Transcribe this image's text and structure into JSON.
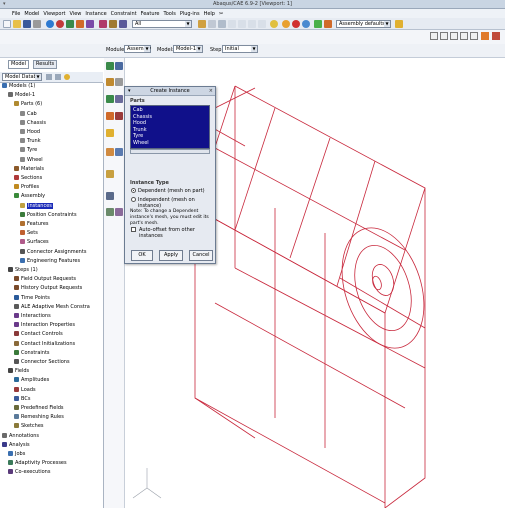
{
  "window": {
    "title": "Abaqus/CAE 6.9-2 [Viewport: 1]"
  },
  "menu": {
    "items": [
      "File",
      "Model",
      "Viewport",
      "View",
      "Instance",
      "Constraint",
      "Feature",
      "Tools",
      "Plug-ins",
      "Help",
      "✂"
    ]
  },
  "toolbar": {
    "render_style_value": "All",
    "assembly_defaults_value": "Assembly defaults"
  },
  "context_bar": {
    "module_label": "Module:",
    "module_value": "Assembly",
    "model_label": "Model:",
    "model_value": "Model-1",
    "step_label": "Step:",
    "step_value": "Initial"
  },
  "tabs": {
    "model": "Model",
    "results": "Results"
  },
  "tree_header": {
    "value": "Model Databa"
  },
  "tree": {
    "items": [
      {
        "label": "Models (1)",
        "indent": 0,
        "icon": "db-icon",
        "color": "#3a6fb0"
      },
      {
        "label": "Model-1",
        "indent": 1,
        "icon": "minus-icon",
        "color": "#6a6a6a"
      },
      {
        "label": "Parts (6)",
        "indent": 2,
        "icon": "parts-icon",
        "color": "#b08a30"
      },
      {
        "label": "Cab",
        "indent": 3,
        "icon": "plus-icon",
        "color": "#888"
      },
      {
        "label": "Chassis",
        "indent": 3,
        "icon": "plus-icon",
        "color": "#888"
      },
      {
        "label": "Hood",
        "indent": 3,
        "icon": "plus-icon",
        "color": "#888"
      },
      {
        "label": "Trunk",
        "indent": 3,
        "icon": "plus-icon",
        "color": "#888"
      },
      {
        "label": "Tyre",
        "indent": 3,
        "icon": "plus-icon",
        "color": "#888"
      },
      {
        "label": "Wheel",
        "indent": 3,
        "icon": "plus-icon",
        "color": "#888"
      },
      {
        "label": "Materials",
        "indent": 2,
        "icon": "materials-icon",
        "color": "#8c5a2a"
      },
      {
        "label": "Sections",
        "indent": 2,
        "icon": "sections-icon",
        "color": "#b03a3a"
      },
      {
        "label": "Profiles",
        "indent": 2,
        "icon": "profiles-icon",
        "color": "#c08a20"
      },
      {
        "label": "Assembly",
        "indent": 2,
        "icon": "assembly-icon",
        "color": "#3a8a3a"
      },
      {
        "label": "Instances",
        "indent": 3,
        "icon": "instances-icon",
        "color": "#c0a040",
        "selected": true
      },
      {
        "label": "Position Constraints",
        "indent": 3,
        "icon": "position-icon",
        "color": "#3a7a3a"
      },
      {
        "label": "Features",
        "indent": 3,
        "icon": "features-icon",
        "color": "#b07030"
      },
      {
        "label": "Sets",
        "indent": 3,
        "icon": "sets-icon",
        "color": "#c06030"
      },
      {
        "label": "Surfaces",
        "indent": 3,
        "icon": "surfaces-icon",
        "color": "#b05a8a"
      },
      {
        "label": "Connector Assignments",
        "indent": 3,
        "icon": "connector-icon",
        "color": "#555"
      },
      {
        "label": "Engineering Features",
        "indent": 3,
        "icon": "engineering-icon",
        "color": "#3a6fb0"
      },
      {
        "label": "Steps (1)",
        "indent": 1,
        "icon": "steps-icon",
        "color": "#444"
      },
      {
        "label": "Field Output Requests",
        "indent": 2,
        "icon": "field-output-icon",
        "color": "#7a4a2a"
      },
      {
        "label": "History Output Requests",
        "indent": 2,
        "icon": "history-output-icon",
        "color": "#7a4a2a"
      },
      {
        "label": "Time Points",
        "indent": 2,
        "icon": "time-icon",
        "color": "#2a5a9a"
      },
      {
        "label": "ALE Adaptive Mesh Constra",
        "indent": 2,
        "icon": "ale-icon",
        "color": "#5a5a5a"
      },
      {
        "label": "Interactions",
        "indent": 2,
        "icon": "interactions-icon",
        "color": "#6a3a8a"
      },
      {
        "label": "Interaction Properties",
        "indent": 2,
        "icon": "interaction-props-icon",
        "color": "#6a3a8a"
      },
      {
        "label": "Contact Controls",
        "indent": 2,
        "icon": "contact-controls-icon",
        "color": "#8a3a3a"
      },
      {
        "label": "Contact Initializations",
        "indent": 2,
        "icon": "contact-init-icon",
        "color": "#8a6a3a"
      },
      {
        "label": "Constraints",
        "indent": 2,
        "icon": "constraints-icon",
        "color": "#3a7a3a"
      },
      {
        "label": "Connector Sections",
        "indent": 2,
        "icon": "connector-sections-icon",
        "color": "#555"
      },
      {
        "label": "Fields",
        "indent": 1,
        "icon": "fields-icon",
        "color": "#444"
      },
      {
        "label": "Amplitudes",
        "indent": 2,
        "icon": "amplitudes-icon",
        "color": "#2a6a9a"
      },
      {
        "label": "Loads",
        "indent": 2,
        "icon": "loads-icon",
        "color": "#9a3a3a"
      },
      {
        "label": "BCs",
        "indent": 2,
        "icon": "bcs-icon",
        "color": "#3a5a9a"
      },
      {
        "label": "Predefined Fields",
        "indent": 2,
        "icon": "predefined-icon",
        "color": "#6a6a3a"
      },
      {
        "label": "Remeshing Rules",
        "indent": 2,
        "icon": "remeshing-icon",
        "color": "#5a7a9a"
      },
      {
        "label": "Sketches",
        "indent": 2,
        "icon": "sketches-icon",
        "color": "#8a7a3a"
      },
      {
        "label": "Annotations",
        "indent": 0,
        "icon": "annotations-icon",
        "color": "#6a6a6a"
      },
      {
        "label": "Analysis",
        "indent": 0,
        "icon": "analysis-icon",
        "color": "#3a3a8a"
      },
      {
        "label": "Jobs",
        "indent": 1,
        "icon": "jobs-icon",
        "color": "#3a6fb0"
      },
      {
        "label": "Adaptivity Processes",
        "indent": 1,
        "icon": "adaptivity-icon",
        "color": "#3a7a5a"
      },
      {
        "label": "Co-executions",
        "indent": 1,
        "icon": "coexec-icon",
        "color": "#5a3a7a"
      }
    ]
  },
  "dialog": {
    "title": "Create Instance",
    "parts_heading": "Parts",
    "parts": [
      "Cab",
      "Chassis",
      "Hood",
      "Trunk",
      "Tyre",
      "Wheel"
    ],
    "instance_type_heading": "Instance Type",
    "radio_dependent": "Dependent (mesh on part)",
    "radio_independent": "Independent (mesh on instance)",
    "note": "Note: To change a Dependent instance's mesh, you must edit its part's mesh.",
    "auto_offset": "Auto-offset from other instances",
    "ok": "OK",
    "apply": "Apply",
    "cancel": "Cancel"
  },
  "colors": {
    "wireframe": "#c8283c",
    "selection": "#1b2bb8",
    "parts_list_bg": "#10108a"
  }
}
